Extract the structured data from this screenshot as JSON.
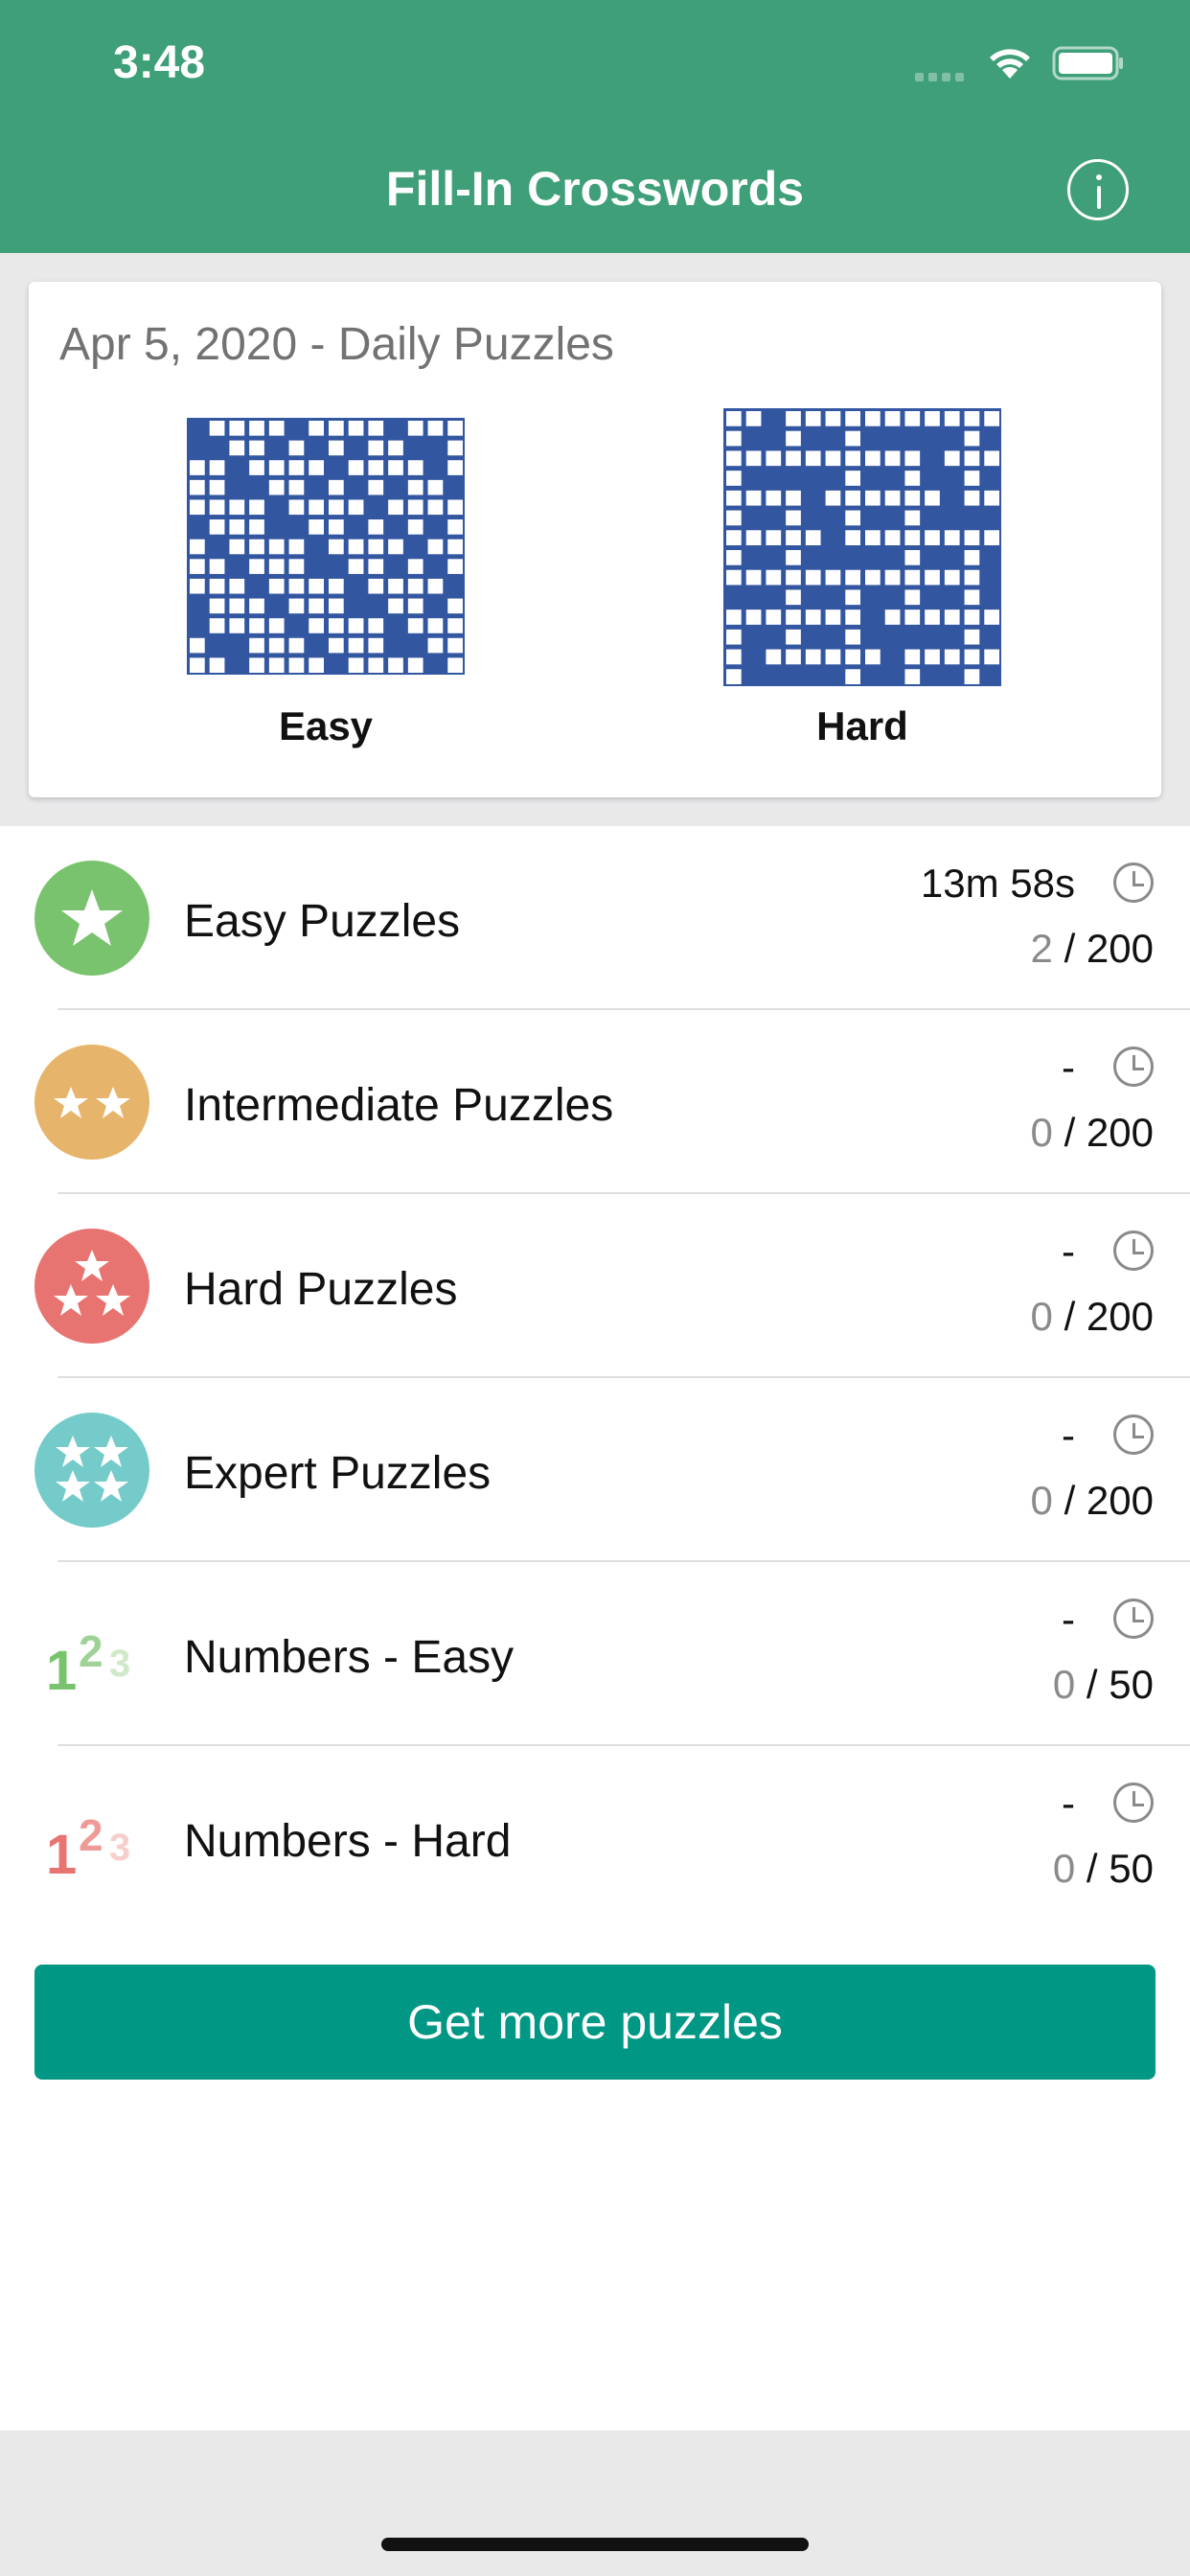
{
  "status_bar": {
    "time": "3:48"
  },
  "nav": {
    "title": "Fill-In Crosswords"
  },
  "daily": {
    "title": "Apr 5, 2020 - Daily Puzzles",
    "easy_label": "Easy",
    "hard_label": "Hard"
  },
  "rows": [
    {
      "label": "Easy Puzzles",
      "time": "13m 58s",
      "done": "2",
      "total": " / 200",
      "icon": "one-star-icon",
      "color": "#7ac36e"
    },
    {
      "label": "Intermediate Puzzles",
      "time": "-",
      "done": "0",
      "total": " / 200",
      "icon": "two-star-icon",
      "color": "#e6b56b"
    },
    {
      "label": "Hard Puzzles",
      "time": "-",
      "done": "0",
      "total": " / 200",
      "icon": "three-star-icon",
      "color": "#e77471"
    },
    {
      "label": "Expert Puzzles",
      "time": "-",
      "done": "0",
      "total": " / 200",
      "icon": "four-star-icon",
      "color": "#74cbc9"
    },
    {
      "label": "Numbers - Easy",
      "time": "-",
      "done": "0",
      "total": " / 50",
      "icon": "numbers-easy-icon",
      "color": "#7ac36e"
    },
    {
      "label": "Numbers - Hard",
      "time": "-",
      "done": "0",
      "total": " / 50",
      "icon": "numbers-hard-icon",
      "color": "#e77471"
    }
  ],
  "more_button": "Get more puzzles"
}
